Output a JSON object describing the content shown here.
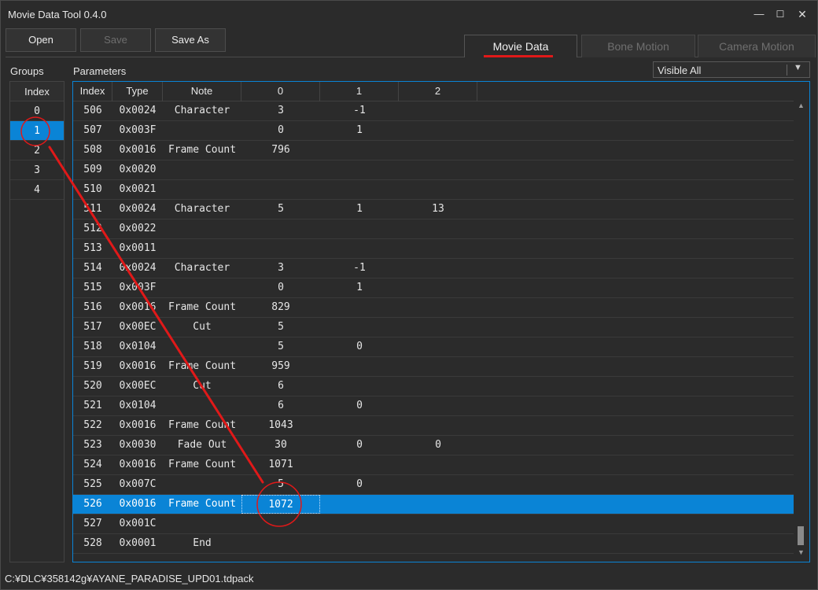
{
  "window": {
    "title": "Movie Data Tool 0.4.0",
    "min_glyph": "—",
    "max_glyph": "☐",
    "close_glyph": "✕"
  },
  "toolbar": {
    "open_label": "Open",
    "save_label": "Save",
    "saveas_label": "Save As"
  },
  "tabs": [
    {
      "label": "Movie Data",
      "active": true
    },
    {
      "label": "Bone Motion",
      "active": false
    },
    {
      "label": "Camera Motion",
      "active": false
    }
  ],
  "groups": {
    "label": "Groups",
    "header": "Index",
    "items": [
      "0",
      "1",
      "2",
      "3",
      "4"
    ],
    "selected_index": 1
  },
  "parameters": {
    "label": "Parameters",
    "filter": {
      "value": "Visible All",
      "arrow": "▼"
    },
    "columns": [
      "Index",
      "Type",
      "Note",
      "0",
      "1",
      "2"
    ],
    "rows": [
      {
        "index": "506",
        "type": "0x0024",
        "note": "Character",
        "v0": "3",
        "v1": "-1",
        "v2": ""
      },
      {
        "index": "507",
        "type": "0x003F",
        "note": "",
        "v0": "0",
        "v1": "1",
        "v2": ""
      },
      {
        "index": "508",
        "type": "0x0016",
        "note": "Frame Count",
        "v0": "796",
        "v1": "",
        "v2": ""
      },
      {
        "index": "509",
        "type": "0x0020",
        "note": "",
        "v0": "",
        "v1": "",
        "v2": ""
      },
      {
        "index": "510",
        "type": "0x0021",
        "note": "",
        "v0": "",
        "v1": "",
        "v2": ""
      },
      {
        "index": "511",
        "type": "0x0024",
        "note": "Character",
        "v0": "5",
        "v1": "1",
        "v2": "13"
      },
      {
        "index": "512",
        "type": "0x0022",
        "note": "",
        "v0": "",
        "v1": "",
        "v2": ""
      },
      {
        "index": "513",
        "type": "0x0011",
        "note": "",
        "v0": "",
        "v1": "",
        "v2": ""
      },
      {
        "index": "514",
        "type": "0x0024",
        "note": "Character",
        "v0": "3",
        "v1": "-1",
        "v2": ""
      },
      {
        "index": "515",
        "type": "0x003F",
        "note": "",
        "v0": "0",
        "v1": "1",
        "v2": ""
      },
      {
        "index": "516",
        "type": "0x0016",
        "note": "Frame Count",
        "v0": "829",
        "v1": "",
        "v2": ""
      },
      {
        "index": "517",
        "type": "0x00EC",
        "note": "Cut",
        "v0": "5",
        "v1": "",
        "v2": ""
      },
      {
        "index": "518",
        "type": "0x0104",
        "note": "",
        "v0": "5",
        "v1": "0",
        "v2": ""
      },
      {
        "index": "519",
        "type": "0x0016",
        "note": "Frame Count",
        "v0": "959",
        "v1": "",
        "v2": ""
      },
      {
        "index": "520",
        "type": "0x00EC",
        "note": "Cut",
        "v0": "6",
        "v1": "",
        "v2": ""
      },
      {
        "index": "521",
        "type": "0x0104",
        "note": "",
        "v0": "6",
        "v1": "0",
        "v2": ""
      },
      {
        "index": "522",
        "type": "0x0016",
        "note": "Frame Count",
        "v0": "1043",
        "v1": "",
        "v2": ""
      },
      {
        "index": "523",
        "type": "0x0030",
        "note": "Fade Out",
        "v0": "30",
        "v1": "0",
        "v2": "0"
      },
      {
        "index": "524",
        "type": "0x0016",
        "note": "Frame Count",
        "v0": "1071",
        "v1": "",
        "v2": ""
      },
      {
        "index": "525",
        "type": "0x007C",
        "note": "",
        "v0": "5",
        "v1": "0",
        "v2": ""
      },
      {
        "index": "526",
        "type": "0x0016",
        "note": "Frame Count",
        "v0": "1072",
        "v1": "",
        "v2": ""
      },
      {
        "index": "527",
        "type": "0x001C",
        "note": "",
        "v0": "",
        "v1": "",
        "v2": ""
      },
      {
        "index": "528",
        "type": "0x0001",
        "note": "End",
        "v0": "",
        "v1": "",
        "v2": ""
      }
    ],
    "selected_row": 20
  },
  "scrollbar": {
    "up": "▲",
    "down": "▼"
  },
  "status": {
    "path": "C:¥DLC¥358142g¥AYANE_PARADISE_UPD01.tdpack"
  },
  "colors": {
    "background": "#2b2b2b",
    "selection": "#0a84d6",
    "annotation": "#e01919",
    "text": "#e6e6e6"
  }
}
